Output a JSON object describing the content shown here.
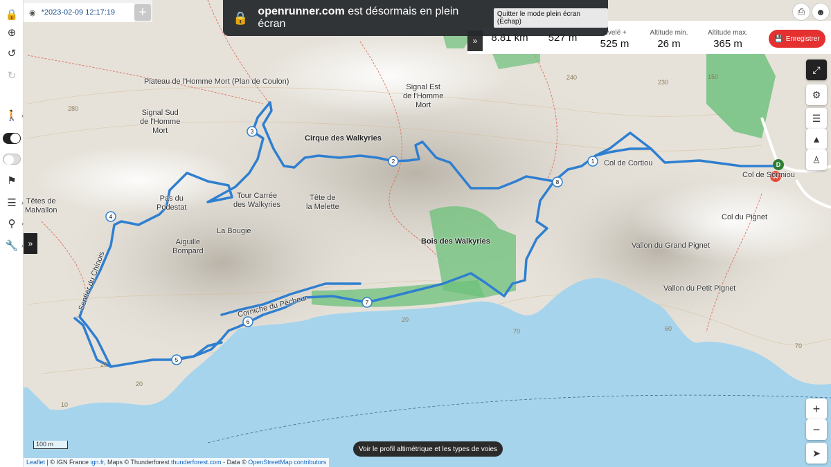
{
  "tab": {
    "title": "*2023-02-09 12:17:19",
    "plus": "+"
  },
  "banner": {
    "domain": "openrunner.com",
    "message": " est désormais en plein écran",
    "quit": "Quitter le mode plein écran (Échap)"
  },
  "stats": [
    {
      "title": "",
      "value": "8.81 km"
    },
    {
      "title": "",
      "value": "527 m"
    },
    {
      "title": "nivelé +",
      "value": "525 m"
    },
    {
      "title": "Altitude min.",
      "value": "26 m"
    },
    {
      "title": "Altitude max.",
      "value": "365 m"
    }
  ],
  "save_label": "Enregistrer",
  "profile_button": "Voir le profil altimétrique et les types de voies",
  "scale": "100 m",
  "attribution": {
    "leaflet": "Leaflet",
    "text1": " | © IGN France ",
    "ign": "ign.fr",
    "text2": ", Maps © Thunderforest ",
    "tf": "thunderforest.com",
    "text3": " - Data © ",
    "osm": "OpenStreetMap contributors"
  },
  "map_labels": {
    "plateau": "Plateau de l'Homme Mort (Plan de Coulon)",
    "signal_sud": "Signal Sud\nde l'Homme\nMort",
    "signal_est": "Signal Est\nde l'Homme\nMort",
    "cirque": "Cirque des Walkyries",
    "tetes": "Têtes de\nMalvallon",
    "pas": "Pas du\nPodestat",
    "tour": "Tour Carrée\ndes Walkyries",
    "tete_melette": "Tête de\nla Melette",
    "bougie": "La Bougie",
    "aiguille": "Aiguille\nBompard",
    "bois": "Bois des Walkyries",
    "col_cortiou": "Col de Cortiou",
    "col_sormiou": "Col de Sormiou",
    "col_pignet": "Col du Pignet",
    "vallon_grand": "Vallon du Grand Pignet",
    "vallon_petit": "Vallon du Petit Pignet",
    "sentier": "Sentier du Chinois",
    "corniche": "Corniche du Pêcheur"
  },
  "contours": [
    "280",
    "240",
    "230",
    "150",
    "20",
    "20",
    "70",
    "70",
    "10",
    "20",
    "60"
  ],
  "markers": [
    "1",
    "2",
    "3",
    "4",
    "5",
    "6",
    "7",
    "8"
  ],
  "start_marker": "A",
  "end_marker": "D",
  "colors": {
    "route": "#2f7fd0",
    "sea": "#a6d4ec",
    "forest": "#6cc07a",
    "save": "#e53030"
  },
  "icons": [
    "lock-icon",
    "zoom-icon",
    "undo-icon",
    "redo-icon",
    "walk-icon",
    "route-toggle-icon",
    "eye-off-icon",
    "flag-icon",
    "menu-icon",
    "pin-icon",
    "wrench-icon",
    "print-icon",
    "user-icon",
    "fullscreen-exit-icon",
    "gear-icon",
    "layers-icon",
    "elevation-icon",
    "pegman-icon",
    "zoom-in-icon",
    "zoom-out-icon",
    "locate-icon"
  ]
}
